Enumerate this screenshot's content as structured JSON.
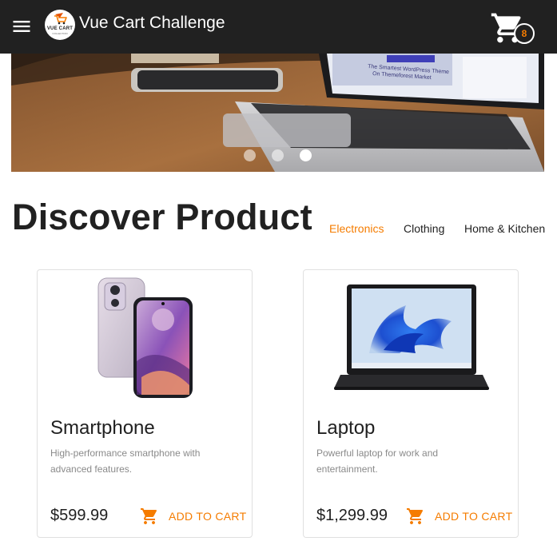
{
  "app": {
    "title": "Vue Cart Challenge",
    "logo_text": "VUE CART",
    "logo_subtext": "COLLECTION",
    "cart_count": "8"
  },
  "colors": {
    "appbar": "#212121",
    "accent": "#f57c00",
    "muted_text": "#8a8a8a"
  },
  "icons": {
    "menu": "menu-icon",
    "cart": "shopping-cart-icon",
    "add_to_cart": "add-shopping-cart-icon"
  },
  "carousel": {
    "slide_count": 3,
    "active_slide": 3,
    "screen_text": [
      "The Smartest WordPress Theme",
      "On Themeforest Market"
    ]
  },
  "section": {
    "title": "Discover Product"
  },
  "filters": [
    {
      "label": "Electronics",
      "active": true
    },
    {
      "label": "Clothing",
      "active": false
    },
    {
      "label": "Home & Kitchen",
      "active": false
    }
  ],
  "products": [
    {
      "name": "Smartphone",
      "description": "High-performance smartphone with advanced features.",
      "price": "$599.99",
      "button": "ADD TO CART",
      "image": "smartphone-image"
    },
    {
      "name": "Laptop",
      "description": "Powerful laptop for work and entertainment.",
      "price": "$1,299.99",
      "button": "ADD TO CART",
      "image": "laptop-image"
    }
  ]
}
